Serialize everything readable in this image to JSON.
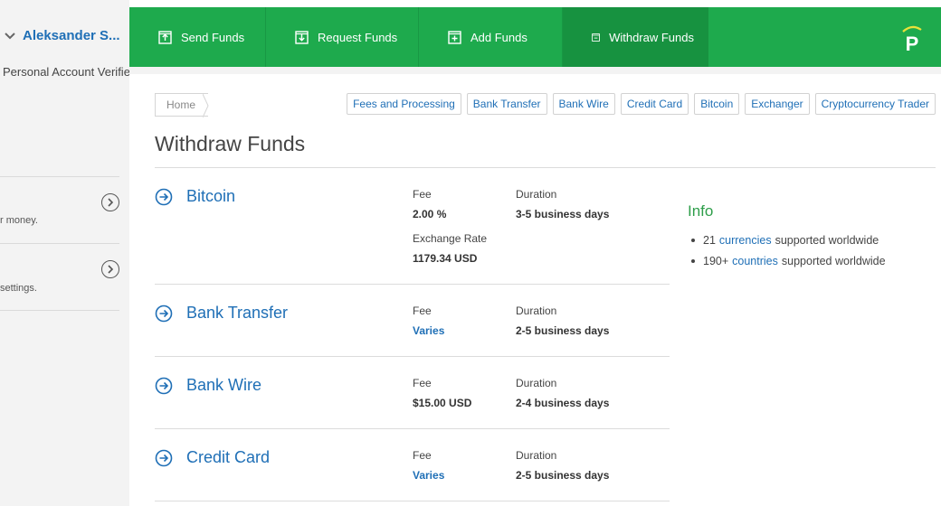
{
  "sidebar": {
    "user_name": "Aleksander S...",
    "account_status": "Personal Account Verified",
    "sections": [
      {
        "desc": "r money."
      },
      {
        "desc": "settings."
      }
    ]
  },
  "topnav": {
    "items": [
      {
        "label": "Send Funds",
        "icon": "send-funds-icon"
      },
      {
        "label": "Request Funds",
        "icon": "request-funds-icon"
      },
      {
        "label": "Add Funds",
        "icon": "add-funds-icon"
      },
      {
        "label": "Withdraw Funds",
        "icon": "withdraw-funds-icon",
        "active": true
      }
    ],
    "logo_letter": "P"
  },
  "breadcrumb": {
    "home": "Home"
  },
  "quicklinks": [
    "Fees and Processing",
    "Bank Transfer",
    "Bank Wire",
    "Credit Card",
    "Bitcoin",
    "Exchanger",
    "Cryptocurrency Trader"
  ],
  "page_title": "Withdraw Funds",
  "labels": {
    "fee": "Fee",
    "duration": "Duration",
    "exchange_rate": "Exchange Rate"
  },
  "methods": [
    {
      "name": "Bitcoin",
      "fee": "2.00 %",
      "duration": "3-5 business days",
      "exchange_rate": "1179.34 USD"
    },
    {
      "name": "Bank Transfer",
      "fee": "Varies",
      "duration": "2-5 business days"
    },
    {
      "name": "Bank Wire",
      "fee": "$15.00 USD",
      "duration": "2-4 business days"
    },
    {
      "name": "Credit Card",
      "fee": "Varies",
      "duration": "2-5 business days"
    }
  ],
  "info": {
    "title": "Info",
    "items": [
      {
        "prefix": "21",
        "link": "currencies",
        "suffix": "supported worldwide"
      },
      {
        "prefix": "190+",
        "link": "countries",
        "suffix": "supported worldwide"
      }
    ]
  },
  "colors": {
    "brand_green": "#1eaa4d",
    "active_green": "#179240",
    "link_blue": "#1f6fb6",
    "info_green": "#2e9e4a"
  }
}
